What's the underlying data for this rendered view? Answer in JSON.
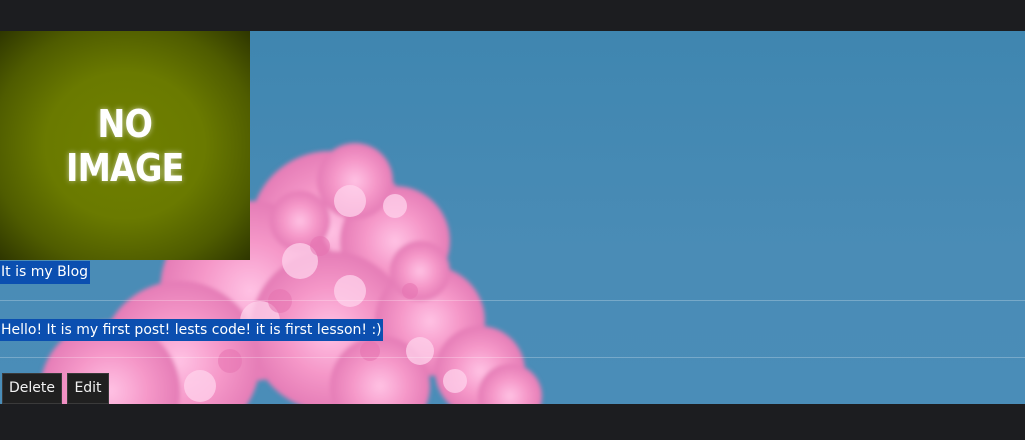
{
  "post": {
    "image_placeholder": "NO\nIMAGE",
    "title": "It is my Blog",
    "body": "Hello! It is my first post! lests code! it is first lesson! :)"
  },
  "actions": {
    "delete_label": "Delete",
    "edit_label": "Edit"
  },
  "colors": {
    "chrome": "#1c1d20",
    "sky": "#4a8cb6",
    "blossom": "#f497c8",
    "placeholder_bg": "#6f8000",
    "text_highlight": "#0b4fb0",
    "button_bg": "#202020"
  }
}
